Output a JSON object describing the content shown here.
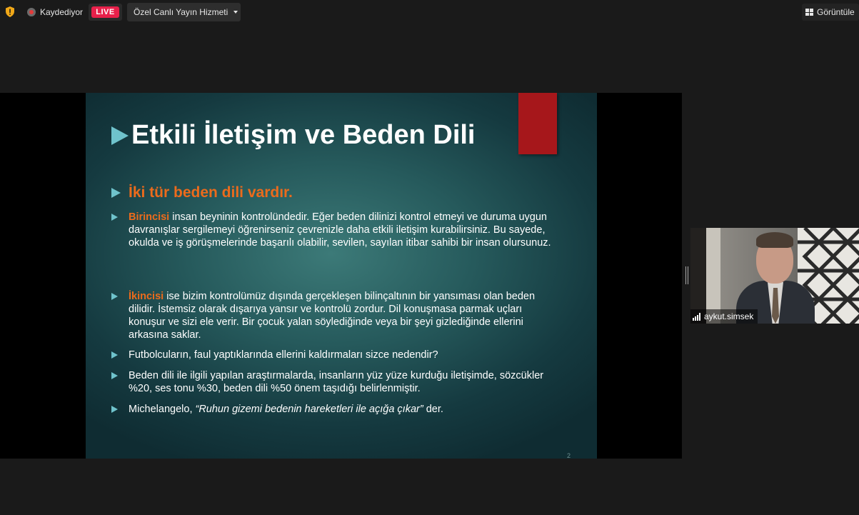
{
  "toolbar": {
    "recording_label": "Kaydediyor",
    "live_label": "LIVE",
    "stream_service_label": "Özel Canlı Yayın Hizmeti",
    "view_label": "Görüntüle",
    "icons": [
      "shield-icon",
      "record-icon",
      "dropdown-caret-icon",
      "grid-view-icon"
    ],
    "colors": {
      "live_badge": "#e8204a",
      "shield": "#f0a818"
    }
  },
  "slide": {
    "title": "Etkili İletişim ve Beden Dili",
    "subheading": "İki tür beden dili vardır.",
    "bullets": [
      {
        "highlight": "Birincisi",
        "text": " insan beyninin kontrolündedir. Eğer beden dilinizi kontrol etmeyi ve duruma uygun davranışlar sergilemeyi öğrenirseniz çevrenizle daha etkili iletişim kurabilirsiniz. Bu sayede, okulda ve iş görüşmelerinde başarılı olabilir, sevilen, sayılan itibar sahibi bir insan olursunuz."
      },
      {
        "highlight": "İkincisi",
        "text": " ise bizim kontrolümüz dışında gerçekleşen bilinçaltının bir yansıması olan beden dilidir. İstemsiz olarak dışarıya yansır ve kontrolü zordur. Dil konuşmasa parmak uçları konuşur ve sizi ele verir. Bir çocuk yalan söylediğinde veya bir şeyi gizlediğinde ellerini arkasına saklar."
      },
      {
        "text": "Futbolcuların, faul yaptıklarında ellerini kaldırmaları sizce nedendir?"
      },
      {
        "text": "Beden dili ile ilgili yapılan araştırmalarda, insanların yüz yüze kurduğu iletişimde, sözcükler %20, ses tonu %30, beden dili %50 önem taşıdığı belirlenmiştir."
      },
      {
        "prefix": "Michelangelo, ",
        "quote": "“Ruhun gizemi bedenin hareketleri ile açığa çıkar”",
        "suffix": " der."
      }
    ],
    "page_number": "2",
    "colors": {
      "accent_orange": "#ec6b1c",
      "arrow_teal": "#6fc3cc",
      "red_block": "#a6171b"
    }
  },
  "participant": {
    "name": "aykut.simsek"
  }
}
